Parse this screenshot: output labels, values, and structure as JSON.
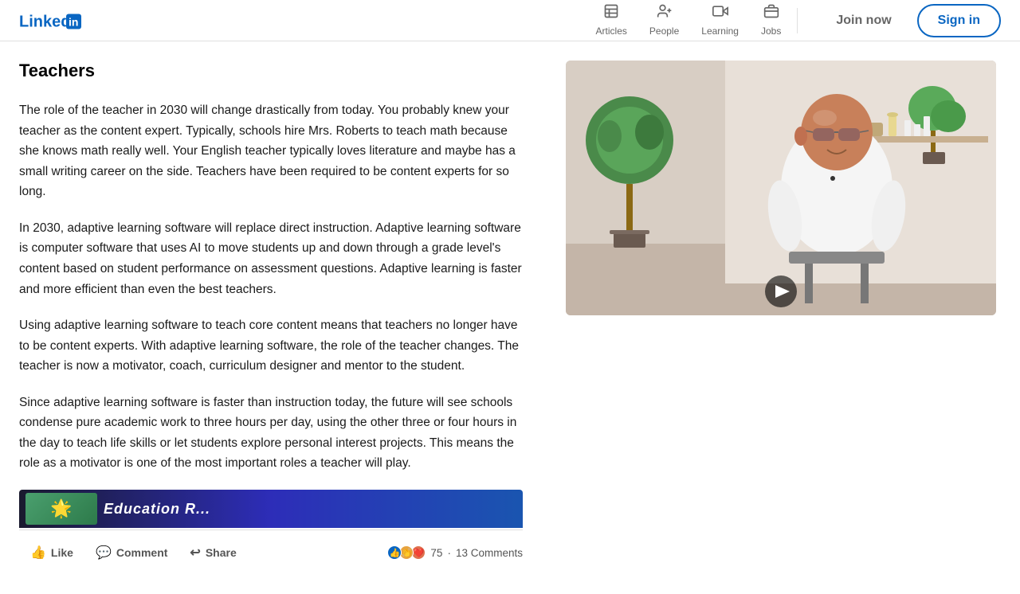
{
  "header": {
    "logo_text": "Linked",
    "logo_in": "in",
    "nav": [
      {
        "id": "articles",
        "label": "Articles",
        "icon": "▦"
      },
      {
        "id": "people",
        "label": "People",
        "icon": "👤"
      },
      {
        "id": "learning",
        "label": "Learning",
        "icon": "▶"
      },
      {
        "id": "jobs",
        "label": "Jobs",
        "icon": "💼"
      }
    ],
    "join_label": "Join now",
    "signin_label": "Sign in"
  },
  "article": {
    "title": "Teachers",
    "paragraphs": [
      "The role of the teacher in 2030 will change drastically from today. You probably knew your teacher as the content expert. Typically, schools hire Mrs. Roberts to teach math because she knows math really well. Your English teacher typically loves literature and maybe has a small writing career on the side. Teachers have been required to be content experts for so long.",
      "In 2030, adaptive learning software will replace direct instruction. Adaptive learning software is computer software that uses AI to move students up and down through a grade level's content based on student performance on assessment questions. Adaptive learning is faster and more efficient than even the best teachers.",
      "Using adaptive learning software to teach core content means that teachers no longer have to be content experts. With adaptive learning software, the role of the teacher changes. The teacher is now a motivator, coach, curriculum designer and mentor to the student.",
      "Since adaptive learning software is faster than instruction today, the future will see schools condense pure academic work to three hours per day, using the other three or four hours in the day to teach life skills or let students explore personal interest projects. This means the role as a motivator is one of the most important roles a teacher will play."
    ],
    "video_preview_text": "Education R..."
  },
  "actions": {
    "like_label": "Like",
    "comment_label": "Comment",
    "share_label": "Share",
    "reaction_count": "75",
    "comments_text": "13 Comments"
  }
}
